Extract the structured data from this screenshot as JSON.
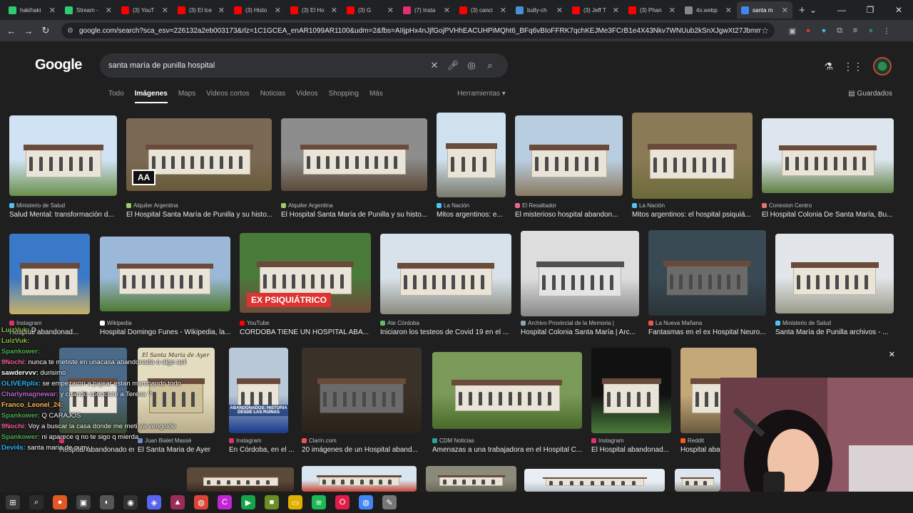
{
  "tabs": [
    {
      "label": "hakihaki",
      "color": "#2ecc71"
    },
    {
      "label": "Stream -",
      "color": "#2ecc71"
    },
    {
      "label": "(3) YouT",
      "color": "#ff0000"
    },
    {
      "label": "(3) El Ice",
      "color": "#ff0000"
    },
    {
      "label": "(3) Histo",
      "color": "#ff0000"
    },
    {
      "label": "(3) El Ho",
      "color": "#ff0000"
    },
    {
      "label": "(3) G",
      "color": "#ff0000"
    },
    {
      "label": "(7) Insta",
      "color": "#e1306c"
    },
    {
      "label": "(3) canci",
      "color": "#ff0000"
    },
    {
      "label": "bully-ch",
      "color": "#4a90d9"
    },
    {
      "label": "(3) Jeff T",
      "color": "#ff0000"
    },
    {
      "label": "(3) Phan",
      "color": "#ff0000"
    },
    {
      "label": "4x.webp",
      "color": "#888888"
    },
    {
      "label": "santa m",
      "color": "#4285f4",
      "active": true
    }
  ],
  "address": {
    "url": "google.com/search?sca_esv=226132a2eb003173&rlz=1C1GCEA_enAR1099AR1100&udm=2&fbs=AIIjpHx4nJjfGojPVHhEACUHPiMQht6_BFq6vBIoFFRK7qchKEJMe3FCrB1e4X43Nkv7WNUub2kSnXJgwXt27JbmmUu7zsv0UYnRoLD4Tu..."
  },
  "google": {
    "logo": "Google",
    "query": "santa maría de punilla hospital",
    "filters": [
      "Todo",
      "Imágenes",
      "Maps",
      "Videos cortos",
      "Noticias",
      "Videos",
      "Shopping",
      "Más"
    ],
    "active_filter": "Imágenes",
    "tools": "Herramientas",
    "saved": "Guardados"
  },
  "results": [
    {
      "source": "Ministerio de Salud",
      "title": "Salud Mental: transformación d...",
      "color": "#4fc3f7"
    },
    {
      "source": "Alquiler Argentina",
      "title": "El Hospital Santa María de Punilla y su histo...",
      "color": "#9ccc65"
    },
    {
      "source": "Alquiler Argentina",
      "title": "El Hospital Santa María de Punilla y su histo...",
      "color": "#9ccc65"
    },
    {
      "source": "La Nación",
      "title": "Mitos argentinos: e...",
      "color": "#4fc3f7"
    },
    {
      "source": "El Resaltador",
      "title": "El misterioso hospital abandon...",
      "color": "#f06292"
    },
    {
      "source": "La Nación",
      "title": "Mitos argentinos: el hospital psiquiá...",
      "color": "#4fc3f7"
    },
    {
      "source": "Conexion Centro",
      "title": "El Hospital Colonia De Santa María, Bu...",
      "color": "#e57373"
    },
    {
      "source": "Instagram",
      "title": "Hospital abandonad...",
      "color": "#e1306c"
    },
    {
      "source": "Wikipedia",
      "title": "Hospital Domingo Funes - Wikipedia, la...",
      "color": "#ffffff"
    },
    {
      "source": "YouTube",
      "title": "CÓRDOBA TIENE UN HOSPITAL ABA...",
      "color": "#ff0000"
    },
    {
      "source": "Ate Córdoba",
      "title": "Iniciaron los testeos de Covid 19 en el ...",
      "color": "#66bb6a"
    },
    {
      "source": "Archivo Provincial de la Memoria |",
      "title": "Hospital Colonia Santa María | Arc...",
      "color": "#90a4ae"
    },
    {
      "source": "La Nueva Mañana",
      "title": "Fantasmas en el ex Hospital Neuro...",
      "color": "#ef5350"
    },
    {
      "source": "Ministerio de Salud",
      "title": "Santa María de Punilla archivos - ...",
      "color": "#4fc3f7"
    },
    {
      "source": "Juan Bialet Massé",
      "title": "El Santa Maria de Ayer",
      "color": "#7986cb"
    },
    {
      "source": "Instagram",
      "title": "En Córdoba, en el ...",
      "color": "#e1306c"
    },
    {
      "source": "Clarín.com",
      "title": "20 imágenes de un Hospital aband...",
      "color": "#ef5350"
    },
    {
      "source": "CDM Noticias",
      "title": "Amenazas a una trabajadora en el Hospital C...",
      "color": "#26a69a"
    },
    {
      "source": "Instagram",
      "title": "El Hospital abandonad...",
      "color": "#e1306c"
    },
    {
      "source": "Reddit",
      "title": "Hospital aba",
      "color": "#ff5722"
    },
    {
      "source": "",
      "title": "Hospital abandonado en Santa Mar...",
      "color": "#e1306c"
    }
  ],
  "overlays": {
    "badge_psiq": "EX PSIQUIÁTRICO",
    "badge_aa": "AA",
    "thumb_text": "ABANDONADOS: HISTORIA DESDE LAS RUINAS",
    "thumb_caption": "El Santa María de Ayer"
  },
  "chat": [
    {
      "user": "LuizVuk:",
      "msg": "D",
      "color": "#8bc34a"
    },
    {
      "user": "LuizVuk:",
      "msg": "",
      "color": "#8bc34a"
    },
    {
      "user": "Spankower:",
      "msg": "",
      "color": "#4caf50"
    },
    {
      "user": "9Nochi:",
      "msg": "nunca te metiste en unacasa abandonada o algo asi? Una vuelta la hicimos con mis amigos",
      "color": "#f06292"
    },
    {
      "user": "sawdervvv:",
      "msg": "durisimo",
      "color": "#ffffff"
    },
    {
      "user": "OLIVERplix:",
      "msg": "se empezaron a pajear estan marchando todo",
      "color": "#29b6f6"
    },
    {
      "user": "Charlymagnewar:",
      "msg": "y cuando conociste a Teresa ?",
      "color": "#ba68c8"
    },
    {
      "user": "Franco_Leonel_24:",
      "msg": "",
      "color": "#ffb74d"
    },
    {
      "user": "Spankower:",
      "msg": "Q CARAJOS",
      "color": "#4caf50"
    },
    {
      "user": "9Nochi:",
      "msg": "Voy a buscar la casa donde me meti ya vengoide",
      "color": "#f06292"
    },
    {
      "user": "Spankower:",
      "msg": "ni aparece q no te sigo q mierda",
      "color": "#4caf50"
    },
    {
      "user": "Devi4s:",
      "msg": "santa maria de puny",
      "color": "#29b6f6"
    }
  ]
}
